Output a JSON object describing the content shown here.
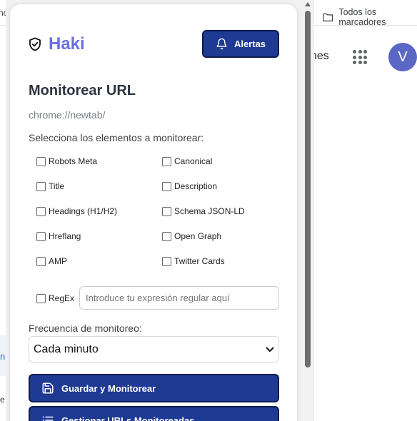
{
  "browser": {
    "left_clipped_text": "no",
    "bookmarks_folder": "Todos los marcadores",
    "ntp_partial_text": "nes",
    "avatar_initial": "V",
    "left_clip_mark": "n",
    "left_clip_mark_2": "e"
  },
  "popup": {
    "logo_text": "Haki",
    "alerts_button": "Alertas",
    "title": "Monitorear URL",
    "url": "chrome://newtab/",
    "select_label": "Selecciona los elementos a monitorear:",
    "checkboxes_left": [
      "Robots Meta",
      "Title",
      "Headings (H1/H2)",
      "Hreflang",
      "AMP"
    ],
    "checkboxes_right": [
      "Canonical",
      "Description",
      "Schema JSON-LD",
      "Open Graph",
      "Twitter Cards"
    ],
    "regex_label": "RegEx",
    "regex_placeholder": "Introduce tu expresión regular aquí",
    "frequency_label": "Frecuencia de monitoreo:",
    "frequency_value": "Cada minuto",
    "save_button": "Guardar y Monitorear",
    "manage_button": "Gestionar URLs Monitoreadas"
  },
  "colors": {
    "brand": "#6a6fe0",
    "primary_button": "#1f3a93",
    "avatar": "#5a67c4"
  }
}
